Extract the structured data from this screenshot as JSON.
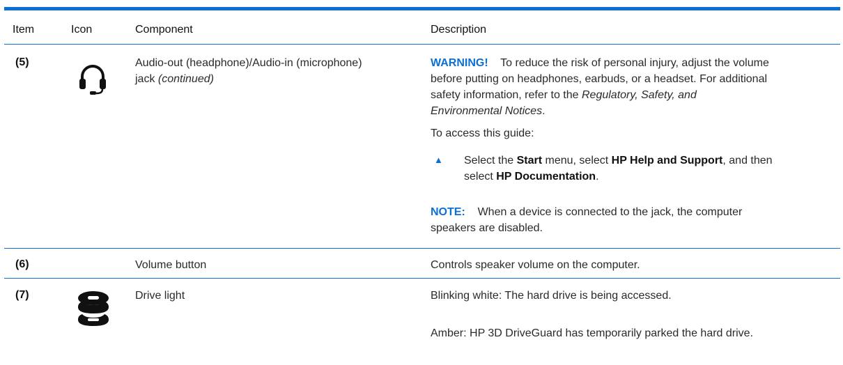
{
  "header": {
    "item": "Item",
    "icon": "Icon",
    "component": "Component",
    "description": "Description"
  },
  "rows": [
    {
      "item": "(5)",
      "icon": "headphone-icon",
      "component": "Audio-out (headphone)/Audio-in (microphone)",
      "component_line2": "jack",
      "component_italic": "(continued)",
      "warning_label": "WARNING!",
      "warning_line1": "To reduce the risk of personal injury, adjust the volume",
      "warning_line2": "before putting on headphones, earbuds, or a headset. For additional",
      "warning_line3": "safety information, refer to the",
      "warning_ref": "Regulatory, Safety, and",
      "warning_ref2": "Environmental Notices",
      "warning_end": ".",
      "access": "To access this guide:",
      "bullet": "▲",
      "step": {
        "t1": "Select the ",
        "b1": "Start",
        "t2": " menu, select ",
        "b2": "HP Help and Support",
        "t3": ", and then",
        "t4": "select ",
        "b3": "HP Documentation",
        "t5": "."
      },
      "note_label": "NOTE:",
      "note_line1": "When a device is connected to the jack, the computer",
      "note_line2": "speakers are disabled."
    },
    {
      "item": "(6)",
      "component": "Volume button",
      "description": "Controls speaker volume on the computer."
    },
    {
      "item": "(7)",
      "icon": "drive-icon",
      "component": "Drive light",
      "desc1": "Blinking white: The hard drive is being accessed.",
      "desc2": "Amber: HP 3D DriveGuard has temporarily parked the hard drive."
    }
  ],
  "colors": {
    "accent": "#0b6fd6",
    "text": "#2a2a2a"
  }
}
